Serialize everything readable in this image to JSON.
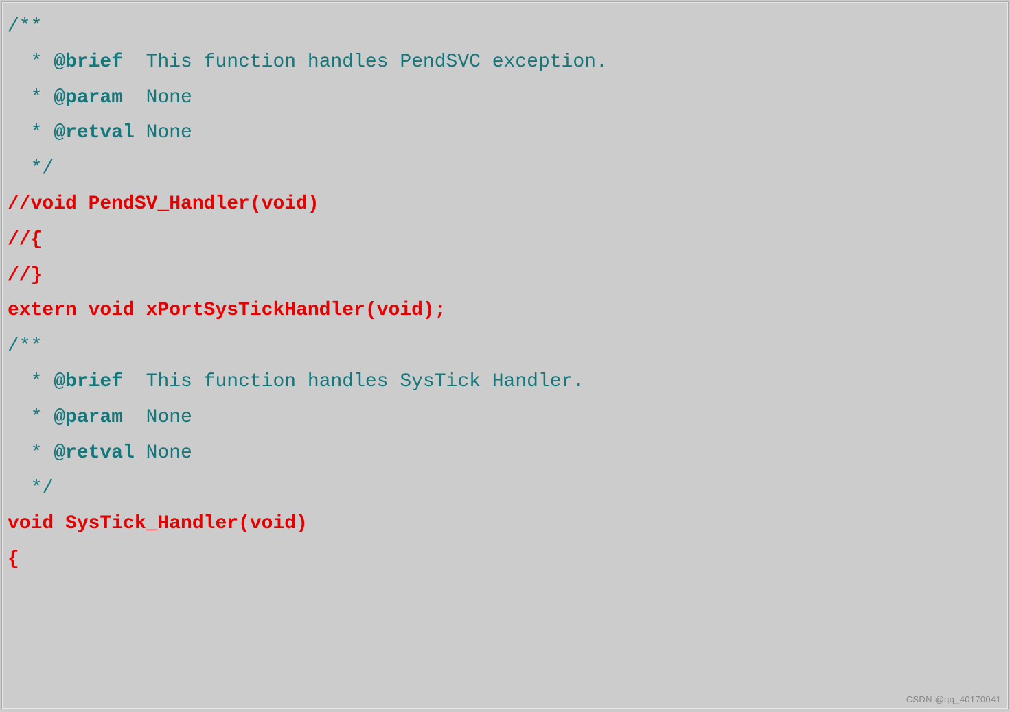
{
  "code": {
    "l1": "/**",
    "l2a": "  * ",
    "l2b": "@brief",
    "l2c": "  This function handles PendSVC exception.",
    "l3a": "  * ",
    "l3b": "@param",
    "l3c": "  None",
    "l4a": "  * ",
    "l4b": "@retval",
    "l4c": " None",
    "l5": "  */",
    "l6": "//void PendSV_Handler(void)",
    "l7": "//{",
    "l8": "//}",
    "l9": "extern void xPortSysTickHandler(void);",
    "l10": "/**",
    "l11a": "  * ",
    "l11b": "@brief",
    "l11c": "  This function handles SysTick Handler.",
    "l12a": "  * ",
    "l12b": "@param",
    "l12c": "  None",
    "l13a": "  * ",
    "l13b": "@retval",
    "l13c": " None",
    "l14": "  */",
    "l15": "void SysTick_Handler(void)",
    "l16": "{"
  },
  "watermark": "CSDN @qq_40170041"
}
